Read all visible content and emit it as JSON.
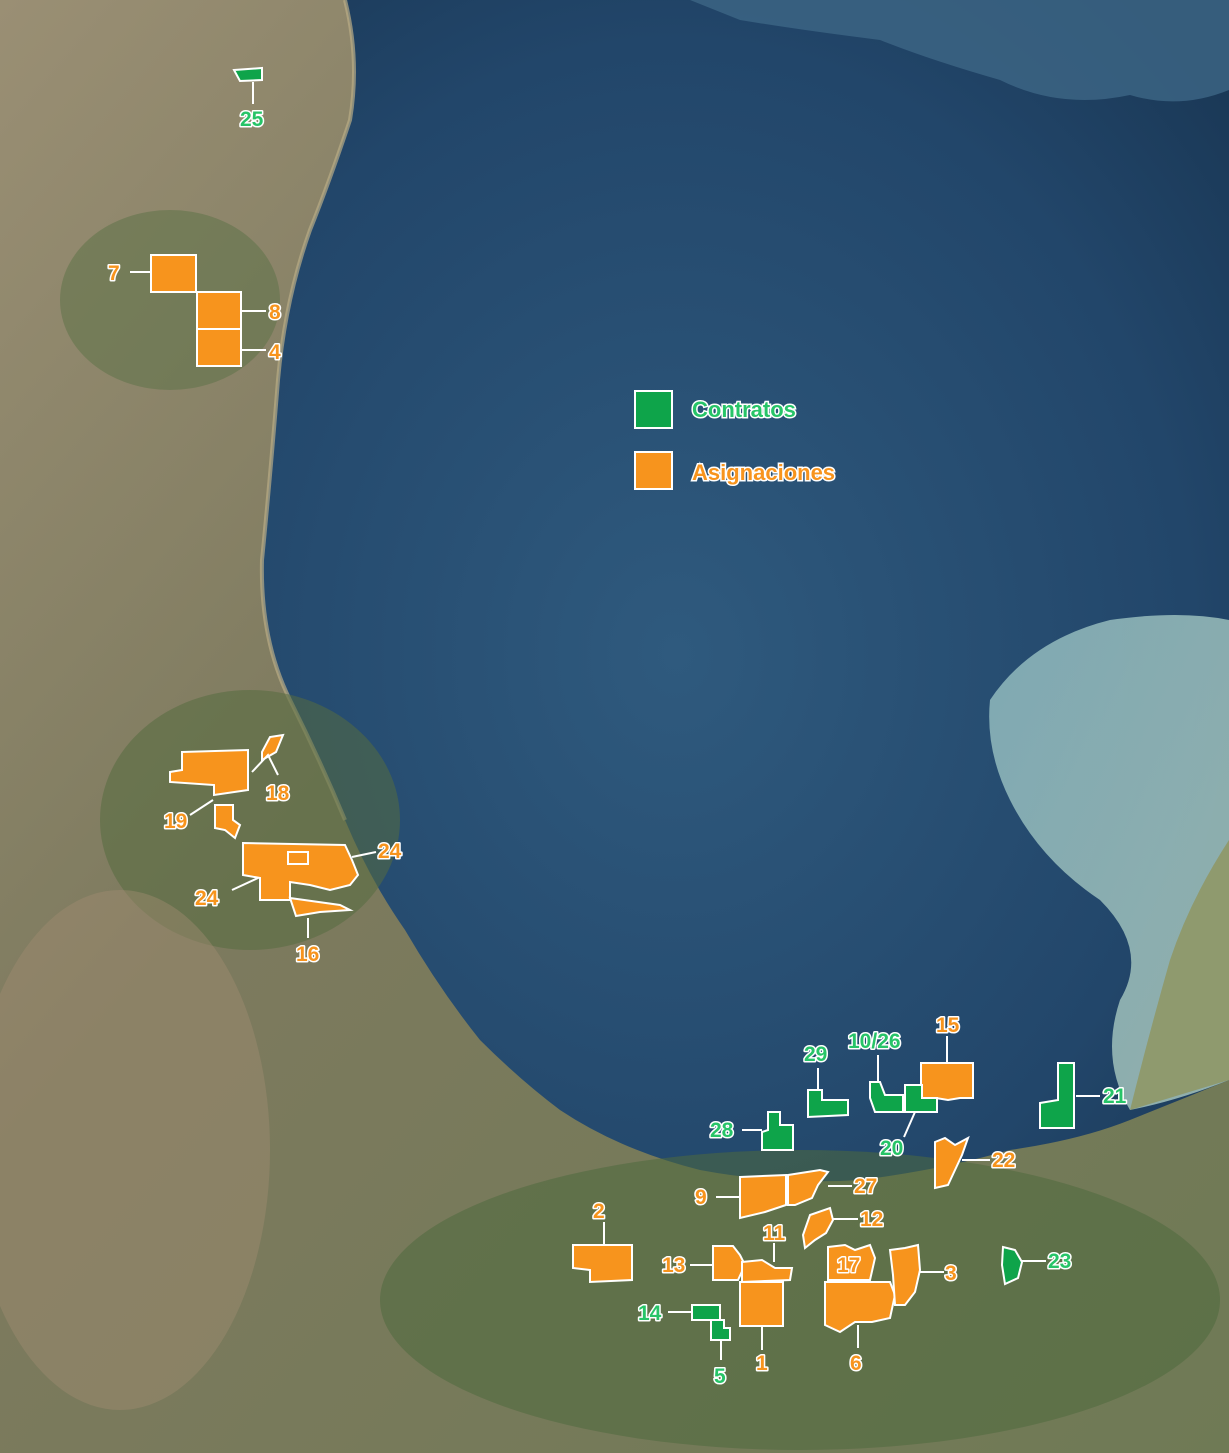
{
  "colors": {
    "contratos": "#0ea44a",
    "asignaciones": "#f7941d",
    "sea_deep": "#1e3d5c",
    "sea_mid": "#2d5578",
    "shelf": "#8fb8c0",
    "land": "#8a826a"
  },
  "legend": {
    "contratos": "Contratos",
    "asignaciones": "Asignaciones"
  },
  "labels": {
    "l25": "25",
    "l7": "7",
    "l8": "8",
    "l4": "4",
    "l18": "18",
    "l19": "19",
    "l24a": "24",
    "l24b": "24",
    "l16": "16",
    "l15": "15",
    "l1026": "10/26",
    "l29": "29",
    "l28": "28",
    "l20": "20",
    "l21": "21",
    "l22": "22",
    "l27": "27",
    "l9": "9",
    "l2": "2",
    "l12": "12",
    "l11": "11",
    "l13": "13",
    "l17": "17",
    "l3": "3",
    "l23": "23",
    "l14": "14",
    "l5": "5",
    "l1": "1",
    "l6": "6"
  }
}
